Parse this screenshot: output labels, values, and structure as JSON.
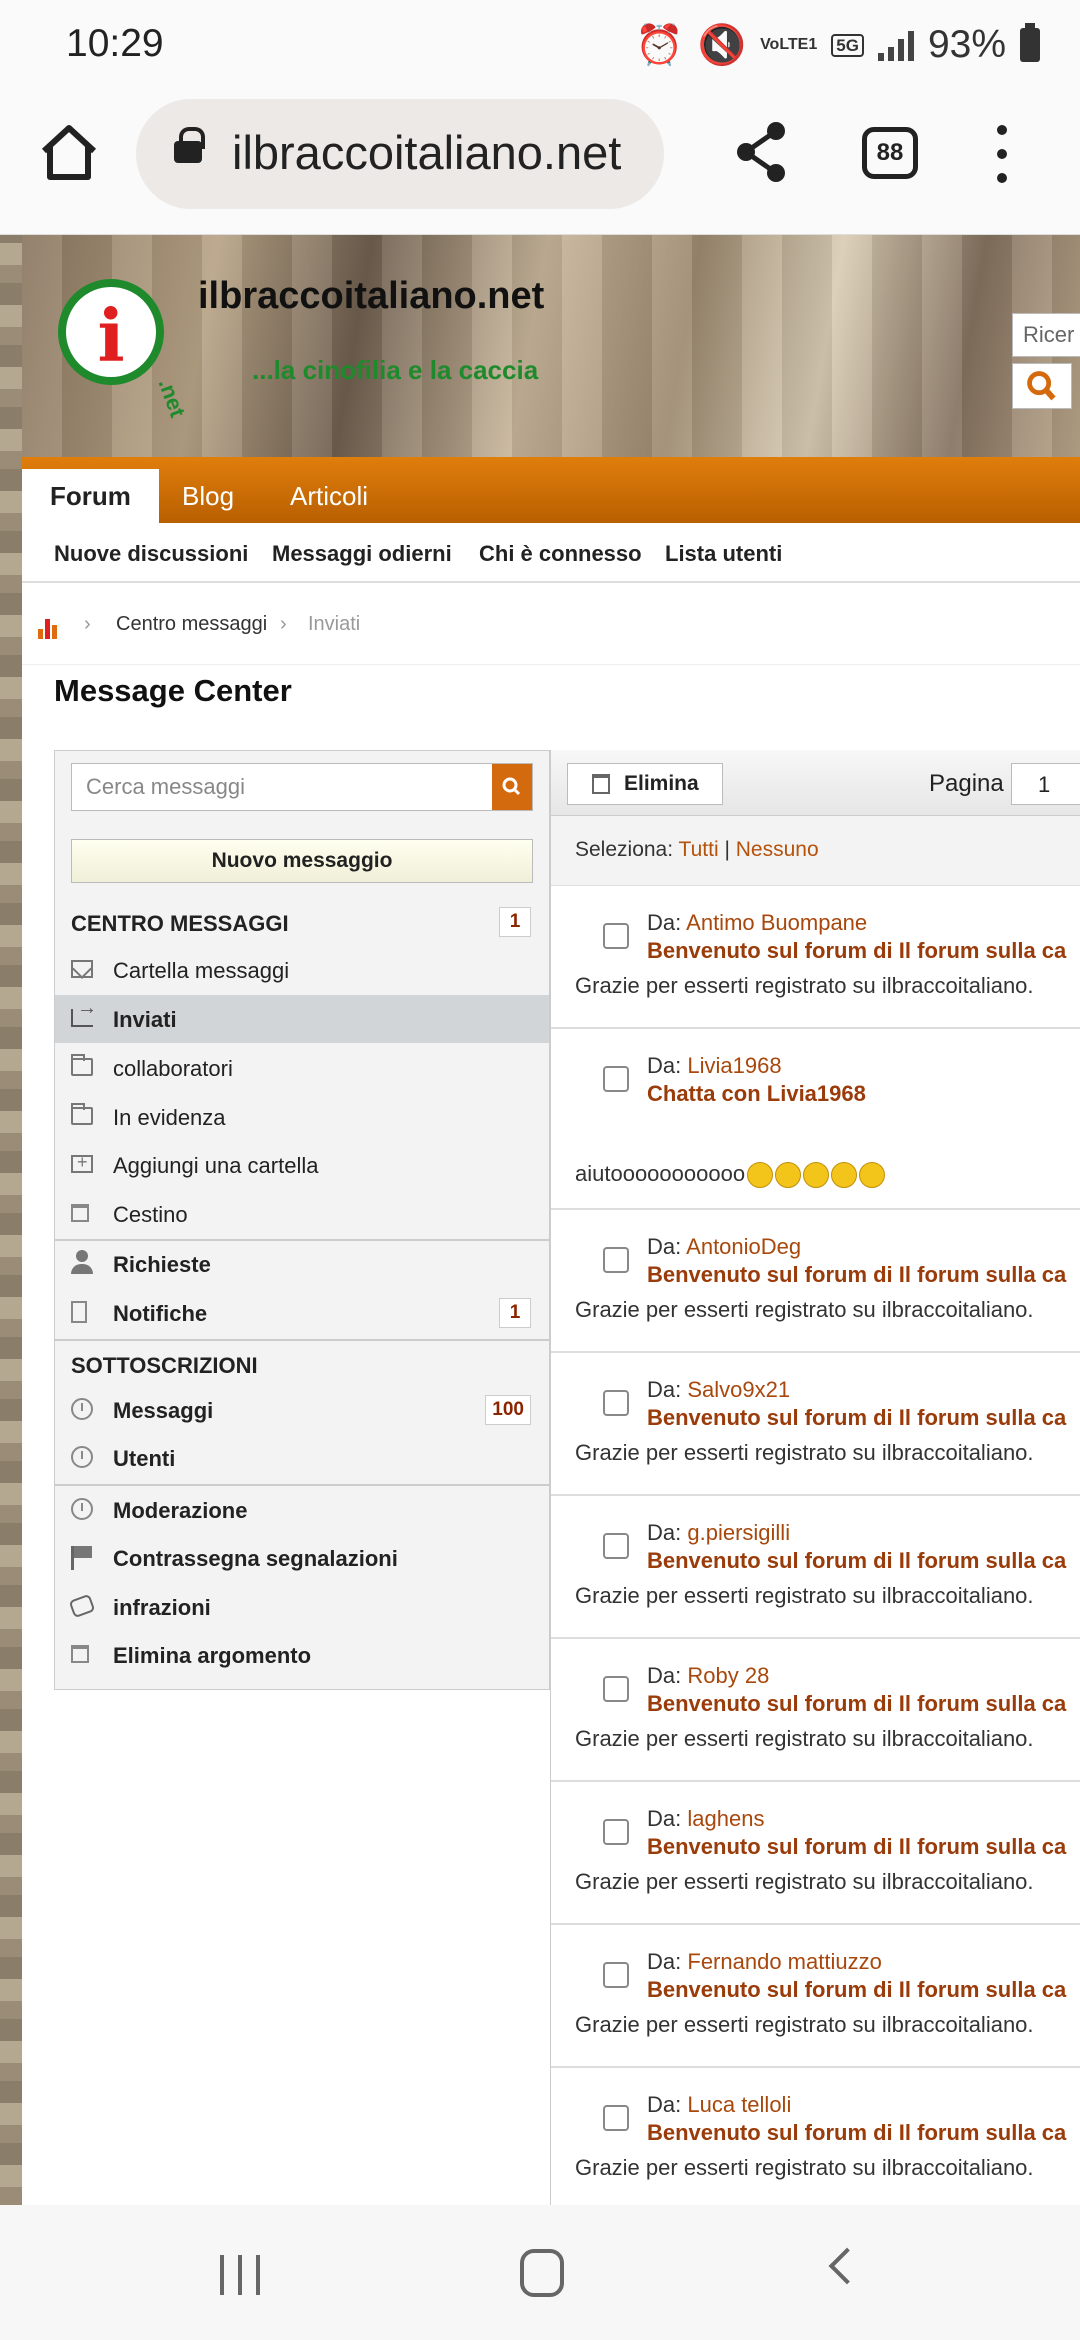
{
  "status_bar": {
    "time": "10:29",
    "battery": "93%",
    "network": "5G",
    "volte": "VoLTE1"
  },
  "browser": {
    "url": "ilbraccoitaliano.net",
    "tab_count": "88"
  },
  "site": {
    "title": "ilbraccoitaliano.net",
    "tagline": "...la cinofilia e la caccia",
    "logo_letter": "i",
    "logo_suffix": ".net",
    "search_placeholder": "Ricer"
  },
  "nav": {
    "tabs": [
      "Forum",
      "Blog",
      "Articoli"
    ],
    "active_tab": "Forum"
  },
  "subnav": [
    "Nuove discussioni",
    "Messaggi odierni",
    "Chi è connesso",
    "Lista utenti"
  ],
  "breadcrumb": {
    "items": [
      "Centro messaggi",
      "Inviati"
    ]
  },
  "page_title": "Message Center",
  "sidebar": {
    "search_placeholder": "Cerca messaggi",
    "new_message": "Nuovo messaggio",
    "section_messages": "CENTRO MESSAGGI",
    "section_messages_count": "1",
    "folders": [
      {
        "label": "Cartella messaggi",
        "icon": "envelope-icon"
      },
      {
        "label": "Inviati",
        "icon": "sent-icon",
        "active": true
      },
      {
        "label": "collaboratori",
        "icon": "folder-icon"
      },
      {
        "label": "In evidenza",
        "icon": "folder-icon"
      },
      {
        "label": "Aggiungi una cartella",
        "icon": "add-folder-icon"
      },
      {
        "label": "Cestino",
        "icon": "trash-icon"
      }
    ],
    "richieste": "Richieste",
    "notifiche": "Notifiche",
    "notifiche_count": "1",
    "section_subs": "SOTTOSCRIZIONI",
    "messaggi": "Messaggi",
    "messaggi_count": "100",
    "utenti": "Utenti",
    "mod_items": [
      "Moderazione",
      "Contrassegna segnalazioni",
      "infrazioni",
      "Elimina argomento"
    ]
  },
  "toolbar": {
    "delete": "Elimina",
    "page_label": "Pagina",
    "page_value": "1"
  },
  "select": {
    "label": "Seleziona:",
    "all": "Tutti",
    "sep": "|",
    "none": "Nessuno"
  },
  "messages_label": "Da:",
  "messages": [
    {
      "from": "Antimo Buompane",
      "subject": "Benvenuto sul forum di Il forum sulla ca",
      "preview": "Grazie per esserti registrato su ilbraccoitaliano."
    },
    {
      "from": "Livia1968",
      "subject": "Chatta con Livia1968",
      "preview": "aiutooooooooooo"
    },
    {
      "from": "AntonioDeg",
      "subject": "Benvenuto sul forum di Il forum sulla ca",
      "preview": "Grazie per esserti registrato su ilbraccoitaliano."
    },
    {
      "from": "Salvo9x21",
      "subject": "Benvenuto sul forum di Il forum sulla ca",
      "preview": "Grazie per esserti registrato su ilbraccoitaliano."
    },
    {
      "from": "g.piersigilli",
      "subject": "Benvenuto sul forum di Il forum sulla ca",
      "preview": "Grazie per esserti registrato su ilbraccoitaliano."
    },
    {
      "from": "Roby 28",
      "subject": "Benvenuto sul forum di Il forum sulla ca",
      "preview": "Grazie per esserti registrato su ilbraccoitaliano."
    },
    {
      "from": "laghens",
      "subject": "Benvenuto sul forum di Il forum sulla ca",
      "preview": "Grazie per esserti registrato su ilbraccoitaliano."
    },
    {
      "from": "Fernando mattiuzzo",
      "subject": "Benvenuto sul forum di Il forum sulla ca",
      "preview": "Grazie per esserti registrato su ilbraccoitaliano."
    },
    {
      "from": "Luca telloli",
      "subject": "Benvenuto sul forum di Il forum sulla ca",
      "preview": "Grazie per esserti registrato su ilbraccoitaliano."
    }
  ]
}
